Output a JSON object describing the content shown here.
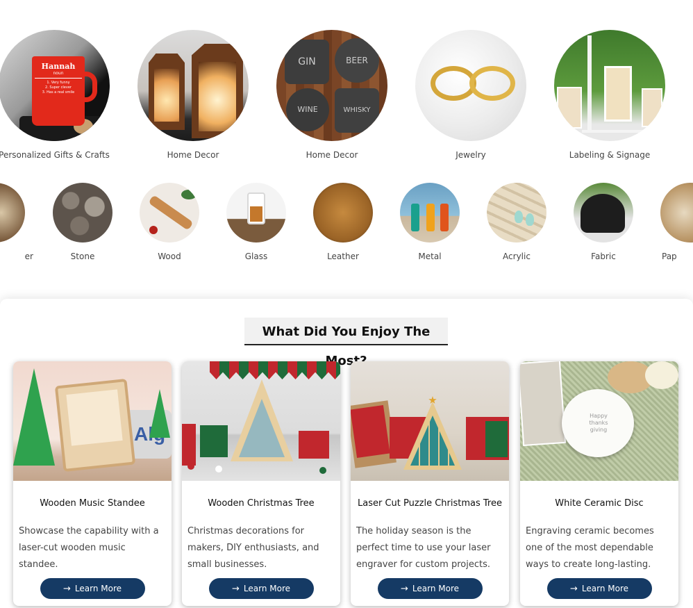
{
  "categories": [
    {
      "label": "Personalized Gifts & Crafts",
      "icon": "red-mug-photo"
    },
    {
      "label": "Home Decor",
      "icon": "wooden-lanterns-photo"
    },
    {
      "label": "Home Decor",
      "icon": "slate-coasters-photo"
    },
    {
      "label": "Jewelry",
      "icon": "gold-rings-photo"
    },
    {
      "label": "Labeling & Signage",
      "icon": "signage-photo"
    }
  ],
  "mug_text": {
    "name": "Hannah",
    "sub": "noun",
    "lines": [
      "1. Very funny",
      "2. Super clever",
      "3. Has a real smile"
    ]
  },
  "coaster_text": [
    "GIN",
    "BEER",
    "WINE",
    "WHISKY"
  ],
  "materials": [
    {
      "label": "er"
    },
    {
      "label": "Stone"
    },
    {
      "label": "Wood"
    },
    {
      "label": "Glass"
    },
    {
      "label": "Leather"
    },
    {
      "label": "Metal"
    },
    {
      "label": "Acrylic"
    },
    {
      "label": "Fabric"
    },
    {
      "label": "Pap"
    }
  ],
  "section": {
    "title": "What Did You Enjoy The Most?"
  },
  "cards": [
    {
      "title": "Wooden Music Standee",
      "desc": "Showcase the capability with a laser-cut wooden music standee.",
      "button": "Learn More"
    },
    {
      "title": "Wooden Christmas Tree",
      "desc": "Christmas decorations for makers, DIY enthusiasts, and small businesses.",
      "button": "Learn More"
    },
    {
      "title": "Laser Cut Puzzle Christmas Tree",
      "desc": "The holiday season is the perfect time to use your laser engraver for custom projects.",
      "button": "Learn More"
    },
    {
      "title": "White Ceramic Disc",
      "desc": "Engraving ceramic becomes one of the most dependable ways to create long-lasting.",
      "button": "Learn More"
    }
  ],
  "plate_text": "Happy thanks giving",
  "brand_text": "Alg",
  "colors": {
    "button": "#153a64",
    "title_bg": "#f1f1f1"
  }
}
